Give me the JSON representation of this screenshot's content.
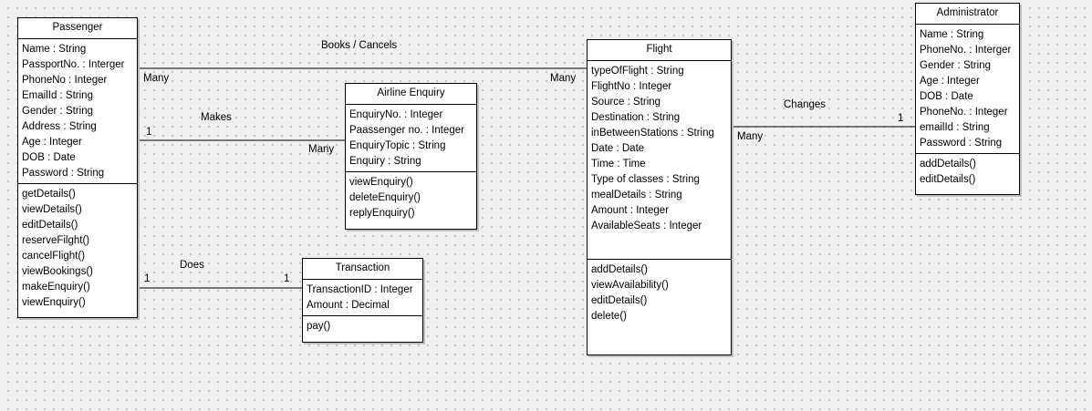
{
  "classes": {
    "passenger": {
      "name": "Passenger",
      "attributes": [
        "Name : String",
        "PassportNo. : Interger",
        "PhoneNo : Integer",
        "EmailId : String",
        "Gender : String",
        "Address : String",
        "Age : Integer",
        "DOB : Date",
        "Password : String"
      ],
      "operations": [
        "getDetails()",
        "viewDetails()",
        "editDetails()",
        "reserveFilght()",
        "cancelFlight()",
        "viewBookings()",
        "makeEnquiry()",
        "viewEnquiry()"
      ]
    },
    "airline_enquiry": {
      "name": "Airline Enquiry",
      "attributes": [
        "EnquiryNo. : Integer",
        "Paassenger no. : Integer",
        "EnquiryTopic : String",
        "Enquiry : String"
      ],
      "operations": [
        "viewEnquiry()",
        "deleteEnquiry()",
        "replyEnquiry()"
      ]
    },
    "transaction": {
      "name": "Transaction",
      "attributes": [
        "TransactionID : Integer",
        "Amount : Decimal"
      ],
      "operations": [
        "pay()"
      ]
    },
    "flight": {
      "name": "Flight",
      "attributes": [
        "typeOfFlight : String",
        "FlightNo : Integer",
        "Source : String",
        "Destination : String",
        "inBetweenStations : String",
        "Date : Date",
        "Time : Time",
        "Type of classes : String",
        "mealDetails : String",
        "Amount : Integer",
        "AvailableSeats : Integer"
      ],
      "operations": [
        "addDetails()",
        "viewAvailability()",
        "editDetails()",
        "delete()"
      ]
    },
    "administrator": {
      "name": "Administrator",
      "attributes": [
        "Name : String",
        "PhoneNo. : Interger",
        "Gender : String",
        "Age : Integer",
        "DOB : Date",
        "PhoneNo. : Integer",
        "emailId : String",
        "Password : String"
      ],
      "operations": [
        "addDetails()",
        "editDetails()"
      ]
    }
  },
  "associations": {
    "books": {
      "label": "Books / Cancels",
      "source_mult": "Many",
      "target_mult": "Many"
    },
    "makes": {
      "label": "Makes",
      "source_mult": "1",
      "target_mult": "Many"
    },
    "does": {
      "label": "Does",
      "source_mult": "1",
      "target_mult": "1"
    },
    "changes": {
      "label": "Changes",
      "source_mult": "Many",
      "target_mult": "1"
    }
  }
}
